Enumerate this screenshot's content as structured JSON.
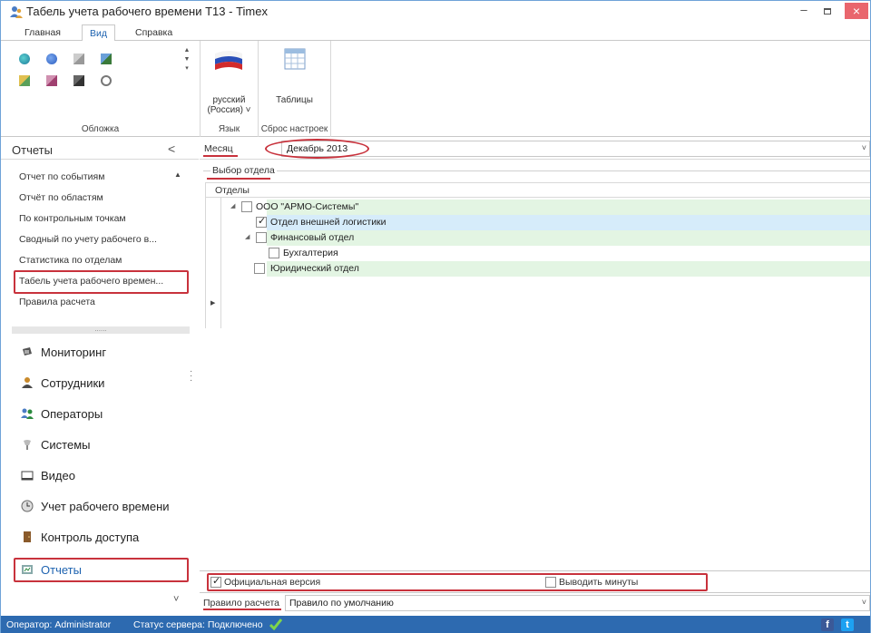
{
  "window": {
    "title": "Табель учета рабочего времени Т13 - Timex",
    "close": "×",
    "minimize": "–"
  },
  "ribbon": {
    "tabs": [
      {
        "label": "Главная",
        "active": false
      },
      {
        "label": "Вид",
        "active": true
      },
      {
        "label": "Справка",
        "active": false
      }
    ],
    "groups": {
      "skins": {
        "label": "Обложка"
      },
      "language": {
        "label": "Язык",
        "button_line1": "русский",
        "button_line2": "(Россия) ˅"
      },
      "reset": {
        "label": "Сброс настроек",
        "button": "Таблицы"
      }
    },
    "gallery_scroll": "▲\n▼\n▾"
  },
  "nav": {
    "header": "Отчеты",
    "collapse": "<",
    "reports": [
      "Отчет по событиям",
      "Отчёт по областям",
      "По контрольным точкам",
      "Сводный по учету рабочего в...",
      "Статистика по отделам",
      "Табель учета рабочего времен...",
      "Правила расчета"
    ],
    "splitter": "......",
    "modules": [
      {
        "label": "Мониторинг",
        "icon": "monitor-icon",
        "color": "#555555"
      },
      {
        "label": "Сотрудники",
        "icon": "employees-icon",
        "color": "#c98a2b"
      },
      {
        "label": "Операторы",
        "icon": "operators-icon",
        "color": "#2b8a3e"
      },
      {
        "label": "Системы",
        "icon": "systems-icon",
        "color": "#888888"
      },
      {
        "label": "Видео",
        "icon": "video-icon",
        "color": "#444444"
      },
      {
        "label": "Учет рабочего времени",
        "icon": "clock-icon",
        "color": "#666666"
      },
      {
        "label": "Контроль доступа",
        "icon": "door-icon",
        "color": "#8a5a2b"
      },
      {
        "label": "Отчеты",
        "icon": "reports-icon",
        "color": "#2b6ab0"
      }
    ],
    "more": "˅"
  },
  "main": {
    "month_label": "Месяц",
    "month_value": "Декабрь 2013",
    "section": "Выбор отдела",
    "tree_header": "Отделы",
    "tree": [
      {
        "label": "ООО \"АРМО-Системы\"",
        "checked": false,
        "expander": "◢"
      },
      {
        "label": "Отдел внешней логистики",
        "checked": true
      },
      {
        "label": "Финансовый отдел",
        "checked": false,
        "expander": "◢"
      },
      {
        "label": "Бухгалтерия",
        "checked": false
      },
      {
        "label": "Юридический отдел",
        "checked": false
      }
    ],
    "row_arrow": "▶",
    "official_label": "Официальная версия",
    "official_checked": true,
    "minutes_label": "Выводить минуты",
    "minutes_checked": false,
    "rule_label": "Правило расчета",
    "rule_value": "Правило по умолчанию",
    "dropdown_glyph": "˅"
  },
  "status": {
    "operator": "Оператор: Administrator",
    "server": "Статус сервера: Подключено"
  },
  "colors": {
    "statusbar": "#2d6ab0",
    "tree_green": "#e3f5e3",
    "tree_blue": "#d6ecfa",
    "highlight": "#c8323c"
  }
}
